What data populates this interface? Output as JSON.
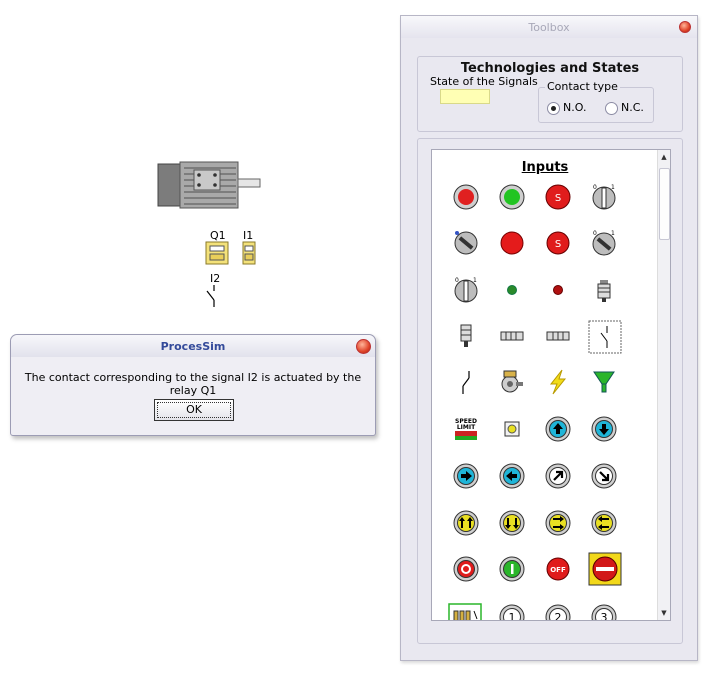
{
  "canvas": {
    "relay_q1_label": "Q1",
    "input_i1_label": "I1",
    "contact_i2_label": "I2"
  },
  "dialog": {
    "title": "ProcesSim",
    "message": "The contact corresponding to the signal I2 is actuated by the relay Q1",
    "ok_label": "OK"
  },
  "toolbox": {
    "title": "Toolbox",
    "section_title": "Technologies and States",
    "state_label": "State of the Signals",
    "contact_type": {
      "legend": "Contact type",
      "options": [
        "N.O.",
        "N.C."
      ],
      "selected": "N.O."
    },
    "inputs_title": "Inputs",
    "icons": [
      "red-button-icon",
      "green-button-icon",
      "red-emergency-button-icon",
      "key-switch-icon",
      "selector-switch-icon",
      "red-mushroom-button-icon",
      "red-emergency-button-2-icon",
      "selector-switch-2-icon",
      "key-selector-icon",
      "green-lamp-icon",
      "red-lamp-icon",
      "proximity-sensor-icon",
      "inductive-sensor-icon",
      "photo-sensor-icon",
      "capacitive-sensor-icon",
      "limit-contact-icon",
      "contact-icon",
      "encoder-icon",
      "lightning-icon",
      "funnel-sensor-icon",
      "speed-limit-icon",
      "yellow-square-button-icon",
      "arrow-up-button-icon",
      "arrow-down-button-icon",
      "arrow-right-button-icon",
      "arrow-left-button-icon",
      "arrow-up-right-button-icon",
      "arrow-down-right-button-icon",
      "double-arrow-up-button-icon",
      "double-arrow-down-button-icon",
      "double-arrow-right-button-icon",
      "double-arrow-left-button-icon",
      "red-ring-button-icon",
      "green-on-button-icon",
      "off-button-icon",
      "no-entry-button-icon",
      "thermal-relay-icon",
      "number-1-button-icon",
      "number-2-button-icon",
      "number-3-button-icon"
    ]
  }
}
